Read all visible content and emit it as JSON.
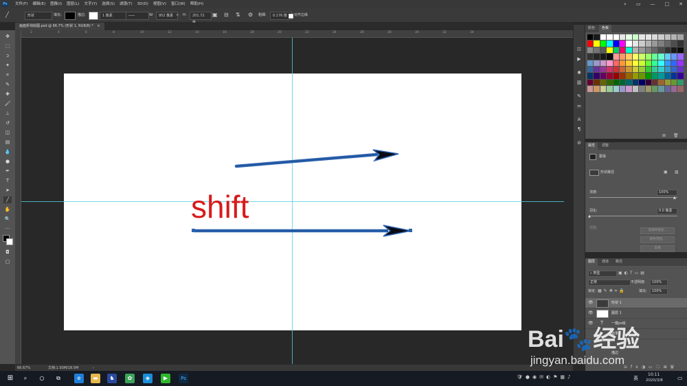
{
  "app": {
    "name": "Photoshop",
    "logo_text": "Ps"
  },
  "menu": [
    "文件(F)",
    "编辑(E)",
    "图像(I)",
    "图层(L)",
    "文字(Y)",
    "选择(S)",
    "滤镜(T)",
    "3D(D)",
    "视图(V)",
    "窗口(W)",
    "帮助(H)"
  ],
  "window_controls": {
    "minimize": "—",
    "maximize": "□",
    "close": "✕"
  },
  "options_bar": {
    "mode": "形状",
    "fill_label": "填充:",
    "stroke_label": "描边:",
    "stroke_width": "1 像素",
    "w_label": "W:",
    "w_value": "952 像素",
    "h_label": "H:",
    "h_value": "201.72 像",
    "weight_label": "粗细:",
    "weight_value": "0.176 像",
    "align_edges_label": "对齐边缘"
  },
  "document": {
    "tab_title": "画面折线绘图.psd @ 66.7% (形状 1, RGB/8) *",
    "canvas_text": "shift"
  },
  "ruler_top": [
    "2",
    "4",
    "6",
    "8",
    "10",
    "12",
    "14",
    "16",
    "18",
    "20",
    "22",
    "24",
    "26",
    "28",
    "30",
    "32",
    "34"
  ],
  "status": {
    "zoom": "66.67%",
    "doc": "文档:1.93M/18.5M"
  },
  "panels": {
    "swatches": {
      "tabs": [
        "颜色",
        "色板"
      ],
      "colors": [
        "#000000",
        "#1a1a1a",
        "#ffffff",
        "#ffffff",
        "#ffffff",
        "#e6e6e6",
        "#e6ffe6",
        "#ccffcc",
        "#e6e6e6",
        "#e6e6e6",
        "#d9d9d9",
        "#cccccc",
        "#c0c0c0",
        "#b3b3b3",
        "#a6a6a6",
        "#ff0000",
        "#ffff00",
        "#00ff00",
        "#00ffff",
        "#0000ff",
        "#ff00ff",
        "#ffffff",
        "#e6e6e6",
        "#cccccc",
        "#b3b3b3",
        "#999999",
        "#808080",
        "#666666",
        "#4d4d4d",
        "#333333",
        "#8c8c8c",
        "#737373",
        "#595959",
        "#ffff00",
        "#00cc66",
        "#ff0066",
        "#00ffcc",
        "#b3b3b3",
        "#999999",
        "#808080",
        "#666666",
        "#4d4d4d",
        "#333333",
        "#1a1a1a",
        "#0d0d0d",
        "#333333",
        "#262626",
        "#1a1a1a",
        "#0d0d0d",
        "#ff9999",
        "#ff9966",
        "#ffcc66",
        "#ffff66",
        "#ccff66",
        "#99ff66",
        "#66ff99",
        "#66ffcc",
        "#66ccff",
        "#6699ff",
        "#9966ff",
        "#6699cc",
        "#9999cc",
        "#cc99cc",
        "#ff99cc",
        "#ff6666",
        "#ff9933",
        "#ffcc33",
        "#ffff33",
        "#ccff33",
        "#66ff33",
        "#33ff99",
        "#33ffff",
        "#3399ff",
        "#3366ff",
        "#9933ff",
        "#336699",
        "#663399",
        "#993399",
        "#cc3366",
        "#cc3333",
        "#cc6633",
        "#cc9933",
        "#cccc33",
        "#99cc33",
        "#33cc33",
        "#33cc99",
        "#33cccc",
        "#3399cc",
        "#3366cc",
        "#6633cc",
        "#003366",
        "#330066",
        "#660066",
        "#990033",
        "#990000",
        "#993300",
        "#996600",
        "#999900",
        "#669900",
        "#009900",
        "#009966",
        "#009999",
        "#006699",
        "#003399",
        "#330099",
        "#660033",
        "#663300",
        "#666600",
        "#336600",
        "#006600",
        "#006633",
        "#006666",
        "#003366",
        "#000066",
        "#330033",
        "#663333",
        "#996633",
        "#999933",
        "#669933",
        "#339966",
        "#cc9999",
        "#cc9966",
        "#cccc99",
        "#99cc99",
        "#99cccc",
        "#9999cc",
        "#cc99cc",
        "#c0c0c0",
        "#808080",
        "#999966",
        "#669966",
        "#669999",
        "#666699",
        "#996699",
        "#996666"
      ]
    },
    "properties": {
      "tabs": [
        "属性",
        "调整"
      ],
      "kind": "蒙版",
      "path_label": "形状路径",
      "density_label": "浓度:",
      "density_value": "100%",
      "feather_label": "羽化:",
      "feather_value": "0.0 像素",
      "refine_label": "调整:",
      "btn_select_mask": "选择并遮住...",
      "btn_color_range": "颜色范围...",
      "btn_invert": "反相"
    },
    "layers": {
      "tabs": [
        "图层",
        "通道",
        "路径"
      ],
      "filter_label": "类型",
      "blend_mode": "正常",
      "opacity_label": "不透明度:",
      "opacity_value": "100%",
      "lock_label": "锁定:",
      "fill_label": "填充:",
      "fill_value": "100%",
      "rows": [
        {
          "name": "形状 1"
        },
        {
          "name": "图层 1"
        },
        {
          "name": "一键ps绘"
        },
        {
          "name": "效果"
        },
        {
          "name": "描边"
        }
      ]
    }
  },
  "taskbar": {
    "time": "10:11",
    "date": "2020/3/8",
    "lang": "英"
  },
  "watermark": {
    "brand": "Bai",
    "brand2": "经验",
    "url": "jingyan.baidu.com"
  }
}
